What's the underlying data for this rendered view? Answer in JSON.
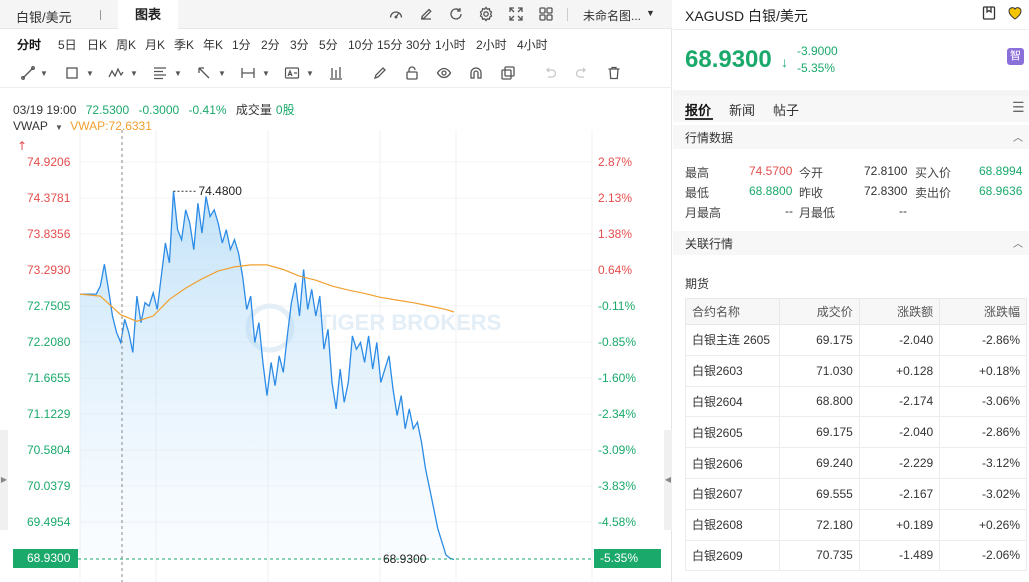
{
  "window": {
    "instrument_tab": "白银/美元",
    "chart_tab": "图表",
    "layout_name": "未命名图..."
  },
  "periods": [
    {
      "label": "分时",
      "active": true
    },
    {
      "label": "5日"
    },
    {
      "label": "日K"
    },
    {
      "label": "周K"
    },
    {
      "label": "月K"
    },
    {
      "label": "季K"
    },
    {
      "label": "年K"
    },
    {
      "label": "1分"
    },
    {
      "label": "2分"
    },
    {
      "label": "3分"
    },
    {
      "label": "5分"
    },
    {
      "label": "10分"
    },
    {
      "label": "15分"
    },
    {
      "label": "30分"
    },
    {
      "label": "1小时"
    },
    {
      "label": "2小时"
    },
    {
      "label": "4小时"
    }
  ],
  "toolbar_icons": [
    "draw-line-icon",
    "rectangle-icon",
    "pattern-icon",
    "fib-icon",
    "ray-icon",
    "measure-icon",
    "text-icon",
    "bars-icon",
    "pencil-icon",
    "lock-icon",
    "eye-icon",
    "magnet-icon",
    "layers-icon",
    "undo-icon",
    "redo-icon",
    "trash-icon"
  ],
  "info": {
    "datetime": "03/19 19:00",
    "price": "72.5300",
    "change": "-0.3000",
    "change_pct": "-0.41%",
    "volume_label": "成交量",
    "volume_value": "0股",
    "vwap_name": "VWAP",
    "vwap_value": "VWAP:72.6331"
  },
  "chart_data": {
    "type": "line",
    "title": "",
    "xlabel": "",
    "ylabel": "",
    "ylim": [
      69.2,
      75.2
    ],
    "prev_close": 72.83,
    "price_ticks": [
      "74.9206",
      "74.3781",
      "73.8356",
      "73.2930",
      "72.7505",
      "72.2080",
      "71.6655",
      "71.1229",
      "70.5804",
      "70.0379",
      "69.4954"
    ],
    "pct_ticks": [
      "2.87%",
      "2.13%",
      "1.38%",
      "0.64%",
      "-0.11%",
      "-0.85%",
      "-1.60%",
      "-2.34%",
      "-3.09%",
      "-3.83%",
      "-4.58%"
    ],
    "grid": true,
    "high_annotation": "74.4800",
    "last_price_label": "68.9300",
    "last_pct_label": "-5.35%",
    "watermark": "TIGER BROKERS",
    "series": [
      {
        "name": "",
        "color": "#2b8be6",
        "x": [
          0,
          1,
          2,
          3,
          4,
          5,
          6,
          7,
          8,
          9,
          10,
          11,
          12,
          13,
          14,
          15,
          16,
          17,
          18,
          19,
          20,
          21,
          22,
          23,
          24,
          25,
          26,
          27,
          28,
          29,
          30,
          31,
          32,
          33,
          34,
          35,
          36,
          37,
          38,
          39,
          40,
          41,
          42,
          43,
          44,
          45,
          46,
          47,
          48,
          49,
          50,
          51,
          52,
          53,
          54,
          55,
          56,
          57,
          58,
          59,
          60,
          61,
          62,
          63,
          64,
          65,
          66,
          67,
          68,
          69,
          70,
          71,
          72,
          73,
          74,
          75,
          76,
          77,
          78,
          79,
          80,
          81,
          82,
          83,
          84,
          85,
          86,
          87,
          88,
          89,
          90,
          91,
          92
        ],
        "values": [
          72.93,
          72.93,
          72.93,
          72.93,
          72.93,
          73.05,
          73.38,
          73.0,
          72.6,
          72.35,
          72.2,
          72.55,
          72.35,
          72.05,
          72.9,
          72.5,
          72.8,
          72.75,
          72.95,
          72.7,
          73.2,
          73.7,
          73.4,
          74.48,
          73.9,
          73.75,
          74.2,
          74.0,
          73.6,
          74.3,
          73.85,
          74.4,
          74.1,
          74.2,
          74.0,
          73.7,
          73.9,
          73.6,
          73.75,
          73.55,
          73.2,
          72.7,
          72.9,
          72.2,
          72.5,
          71.9,
          71.4,
          71.9,
          71.55,
          72.0,
          71.75,
          72.3,
          72.8,
          73.1,
          72.6,
          73.3,
          72.7,
          73.0,
          72.6,
          72.9,
          72.1,
          72.4,
          71.6,
          71.2,
          71.8,
          71.3,
          71.6,
          72.3,
          72.1,
          72.2,
          71.9,
          72.3,
          71.8,
          72.2,
          71.6,
          71.8,
          72.0,
          71.5,
          71.1,
          71.4,
          70.9,
          71.2,
          70.9,
          71.0,
          70.7,
          70.3,
          70.0,
          69.7,
          69.4,
          69.2,
          69.0,
          68.95,
          68.93
        ]
      },
      {
        "name": "VWAP",
        "color": "#f0a030",
        "x": [
          0,
          5,
          10,
          14,
          18,
          22,
          26,
          30,
          34,
          38,
          42,
          46,
          50,
          54,
          58,
          62,
          66,
          70,
          74,
          78,
          82,
          86,
          90,
          92
        ],
        "values": [
          72.93,
          72.9,
          72.62,
          72.52,
          72.6,
          72.85,
          73.02,
          73.16,
          73.28,
          73.34,
          73.37,
          73.37,
          73.3,
          73.2,
          73.14,
          73.05,
          72.99,
          72.94,
          72.88,
          72.84,
          72.8,
          72.75,
          72.7,
          72.66
        ]
      }
    ]
  },
  "right": {
    "title": "XAGUSD 白银/美元",
    "last_price": "68.9300",
    "change": "-3.9000",
    "change_pct": "-5.35%",
    "badge": "智",
    "tabs": [
      "报价",
      "新闻",
      "帖子"
    ],
    "market_section": "行情数据",
    "stats": {
      "high_label": "最高",
      "high": "74.5700",
      "open_label": "今开",
      "open": "72.8100",
      "bid_label": "买入价",
      "bid": "68.8994",
      "low_label": "最低",
      "low": "68.8800",
      "prev_label": "昨收",
      "prev": "72.8300",
      "ask_label": "卖出价",
      "ask": "68.9636",
      "month_high_label": "月最高",
      "month_high": "--",
      "month_low_label": "月最低",
      "month_low": "--"
    },
    "related_section": "关联行情",
    "futures_title": "期货",
    "futures_headers": [
      "合约名称",
      "成交价",
      "涨跌额",
      "涨跌幅"
    ],
    "futures": [
      {
        "name": "白银主连 2605",
        "price": "69.175",
        "change": "-2.040",
        "pct": "-2.86%",
        "dir": "down"
      },
      {
        "name": "白银2603",
        "price": "71.030",
        "change": "+0.128",
        "pct": "+0.18%",
        "dir": "up"
      },
      {
        "name": "白银2604",
        "price": "68.800",
        "change": "-2.174",
        "pct": "-3.06%",
        "dir": "down"
      },
      {
        "name": "白银2605",
        "price": "69.175",
        "change": "-2.040",
        "pct": "-2.86%",
        "dir": "down"
      },
      {
        "name": "白银2606",
        "price": "69.240",
        "change": "-2.229",
        "pct": "-3.12%",
        "dir": "down"
      },
      {
        "name": "白银2607",
        "price": "69.555",
        "change": "-2.167",
        "pct": "-3.02%",
        "dir": "down"
      },
      {
        "name": "白银2608",
        "price": "72.180",
        "change": "+0.189",
        "pct": "+0.26%",
        "dir": "up"
      },
      {
        "name": "白银2609",
        "price": "70.735",
        "change": "-1.489",
        "pct": "-2.06%",
        "dir": "down"
      }
    ]
  }
}
